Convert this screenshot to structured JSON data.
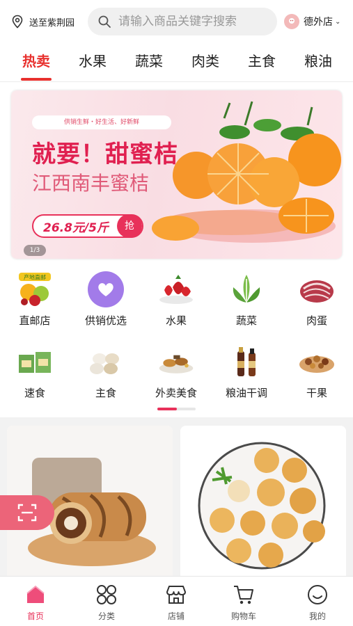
{
  "header": {
    "location_label": "送至紫荆园",
    "search_placeholder": "请输入商品关键字搜索",
    "store_name": "德外店"
  },
  "tabs": [
    {
      "label": "热卖",
      "active": true
    },
    {
      "label": "水果"
    },
    {
      "label": "蔬菜"
    },
    {
      "label": "肉类"
    },
    {
      "label": "主食"
    },
    {
      "label": "粮油"
    }
  ],
  "banner": {
    "tagline": "供销生鲜・好生活、好新鲜",
    "headline": "就要！甜蜜桔",
    "subheadline": "江西南丰蜜桔",
    "price": "26.8元/5斤",
    "grab_label": "抢",
    "pager": "1/3"
  },
  "categories": [
    {
      "label": "直邮店",
      "icon": "origin-direct-icon",
      "badge": "产地直邮"
    },
    {
      "label": "供销优选",
      "icon": "heart-icon"
    },
    {
      "label": "水果",
      "icon": "strawberry-icon"
    },
    {
      "label": "蔬菜",
      "icon": "vegetable-icon"
    },
    {
      "label": "肉蛋",
      "icon": "meat-icon"
    },
    {
      "label": "速食",
      "icon": "instant-food-icon"
    },
    {
      "label": "主食",
      "icon": "buns-icon"
    },
    {
      "label": "外卖美食",
      "icon": "takeout-food-icon"
    },
    {
      "label": "粮油干调",
      "icon": "oil-sauce-icon"
    },
    {
      "label": "干果",
      "icon": "dried-fruit-icon"
    }
  ],
  "category_scroll_fraction": 0.5,
  "products": [
    {
      "image": "swiss-roll-cake-image"
    },
    {
      "image": "cream-puff-plate-image"
    }
  ],
  "bottom_nav": [
    {
      "label": "首页",
      "icon": "home-icon",
      "active": true
    },
    {
      "label": "分类",
      "icon": "category-grid-icon"
    },
    {
      "label": "店铺",
      "icon": "shop-icon"
    },
    {
      "label": "购物车",
      "icon": "cart-icon"
    },
    {
      "label": "我的",
      "icon": "smiley-profile-icon"
    }
  ],
  "colors": {
    "accent": "#e8312e",
    "pink": "#e8315a",
    "active_nav": "#e8315a"
  }
}
